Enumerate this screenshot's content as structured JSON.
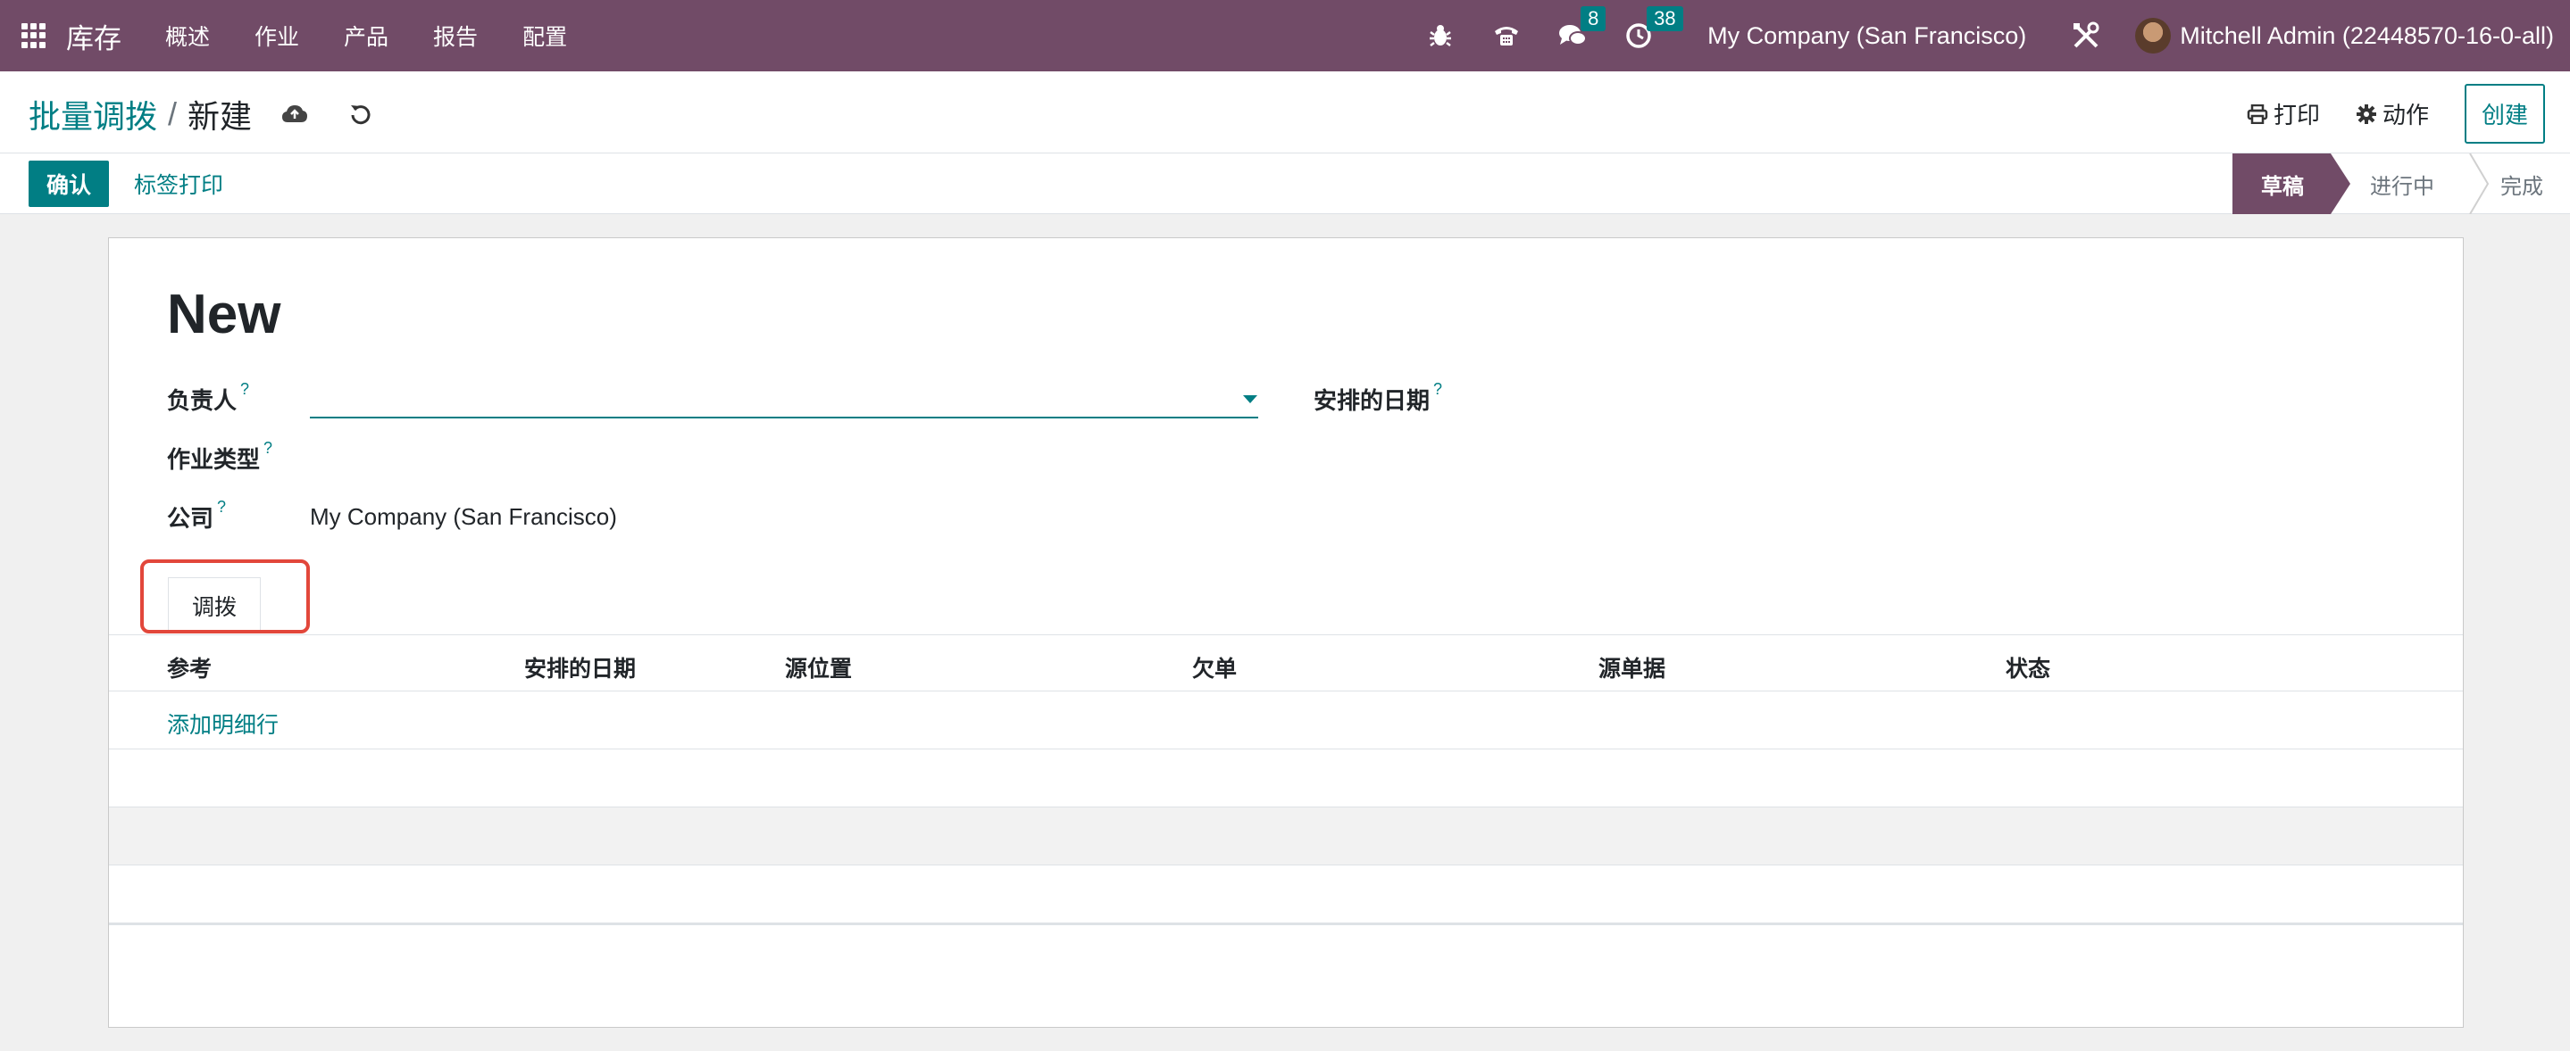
{
  "navbar": {
    "app_name": "库存",
    "menu": [
      "概述",
      "作业",
      "产品",
      "报告",
      "配置"
    ],
    "messages_count": "8",
    "activities_count": "38",
    "company": "My Company (San Francisco)",
    "user": "Mitchell Admin (22448570-16-0-all)"
  },
  "breadcrumb": {
    "parent": "批量调拨",
    "separator": "/",
    "current": "新建"
  },
  "actions": {
    "print": "打印",
    "action": "动作",
    "create": "创建"
  },
  "statusbar": {
    "confirm": "确认",
    "print_labels": "标签打印",
    "stages": [
      "草稿",
      "进行中",
      "完成"
    ],
    "active_stage": "草稿"
  },
  "form": {
    "title": "New",
    "responsible_label": "负责人",
    "scheduled_date_label": "安排的日期",
    "operation_type_label": "作业类型",
    "company_label": "公司",
    "company_value": "My Company (San Francisco)",
    "help_mark": "?"
  },
  "tabs": {
    "transfers": "调拨"
  },
  "table": {
    "columns": [
      "参考",
      "安排的日期",
      "源位置",
      "欠单",
      "源单据",
      "状态"
    ],
    "add_line": "添加明细行"
  },
  "colors": {
    "navbar": "#714b67",
    "accent": "#017e84",
    "highlight": "#e2473b"
  }
}
